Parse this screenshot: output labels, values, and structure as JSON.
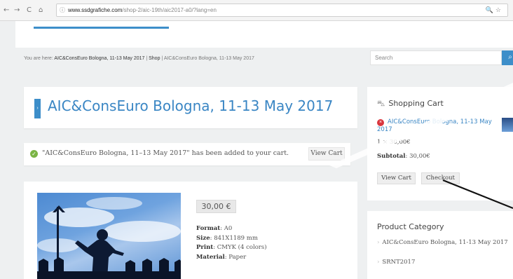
{
  "browser": {
    "back": "←",
    "forward": "→",
    "reload": "C",
    "home": "⌂",
    "info": "ⓘ",
    "url_host": "www.ssdgrafiche.com",
    "url_path": "/shop-2/aic-19th/aic2017-a0/?lang=en",
    "right_icons": "🔍☆"
  },
  "breadcrumb": {
    "prefix": "You are here: ",
    "item1": "AIC&ConsEuro Bologna, 11-13 May 2017",
    "sep1": " | ",
    "item2": "Shop",
    "sep2": " | ",
    "current": "AIC&ConsEuro Bologna, 11-13 May 2017"
  },
  "search": {
    "placeholder": "Search",
    "icon": "magnifier-icon",
    "glyph": "⌕"
  },
  "title": {
    "text": "AIC&ConsEuro Bologna, 11-13 May 2017",
    "marker": "›"
  },
  "notice": {
    "text": "\"AIC&ConsEuro Bologna, 11–13 May 2017\" has been added to your cart.",
    "button": "View Cart",
    "icon_glyph": "✓"
  },
  "product": {
    "price": "30,00 €",
    "specs": [
      {
        "label": "Format",
        "value": "A0"
      },
      {
        "label": "Size",
        "value": "841X1189 mm"
      },
      {
        "label": "Print",
        "value": "CMYK (4 colors)"
      },
      {
        "label": "Material",
        "value": "Paper"
      }
    ]
  },
  "cart": {
    "heading": "Shopping Cart",
    "icon_glyph": "⛍",
    "item_name": "AIC&ConsEuro Bologna, 11-13 May 2017",
    "remove_glyph": "×",
    "quantity": "1 × 30,00€",
    "subtotal_label": "Subtotal",
    "subtotal_value": ": 30,00€",
    "view_cart": "View Cart",
    "checkout": "Checkout"
  },
  "categories": {
    "heading": "Product Category",
    "items": [
      "AIC&ConsEuro Bologna, 11-13 May 2017",
      "SRNT2017"
    ],
    "arrow": "›"
  },
  "colors": {
    "accent": "#3d8ec9",
    "link": "#3a86c4",
    "success": "#7bb445",
    "remove": "#d9363e"
  }
}
